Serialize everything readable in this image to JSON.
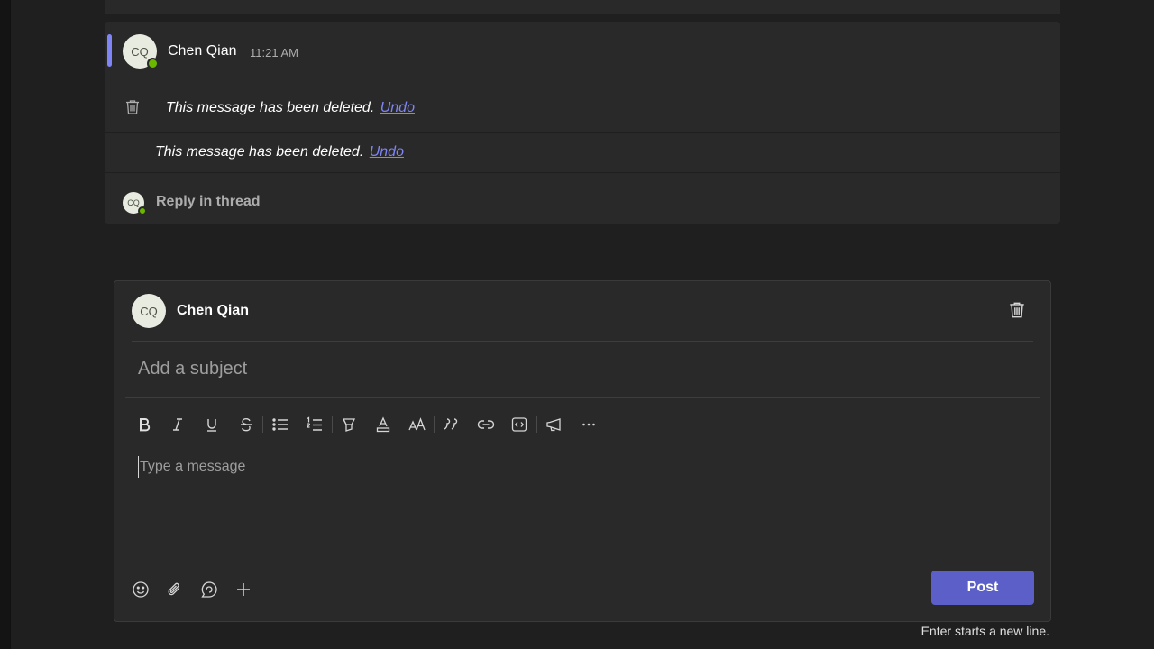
{
  "thread": {
    "sender_initials": "CQ",
    "sender_name": "Chen Qian",
    "timestamp": "11:21 AM",
    "messages": [
      {
        "text": "This message has been deleted.",
        "undo_label": "Undo"
      },
      {
        "text": "This message has been deleted.",
        "undo_label": "Undo"
      }
    ],
    "reply_initials": "CQ",
    "reply_label": "Reply in thread"
  },
  "compose": {
    "author_initials": "CQ",
    "author_name": "Chen Qian",
    "subject_placeholder": "Add a subject",
    "message_placeholder": "Type a message",
    "toolbar": [
      "bold-icon",
      "italic-icon",
      "underline-icon",
      "strikethrough-icon",
      "bulleted-list-icon",
      "numbered-list-icon",
      "highlight-icon",
      "font-color-icon",
      "font-size-icon",
      "quote-icon",
      "link-icon",
      "code-snippet-icon",
      "announcement-icon",
      "more-options-icon"
    ],
    "bottom_actions": [
      "emoji-icon",
      "attach-icon",
      "loop-icon",
      "add-icon"
    ],
    "post_label": "Post",
    "hint": "Enter starts a new line."
  },
  "colors": {
    "background": "#1f1f1f",
    "card": "#292929",
    "accent": "#7f85f5",
    "post_button": "#5b5fc7",
    "presence": "#6bb700"
  }
}
